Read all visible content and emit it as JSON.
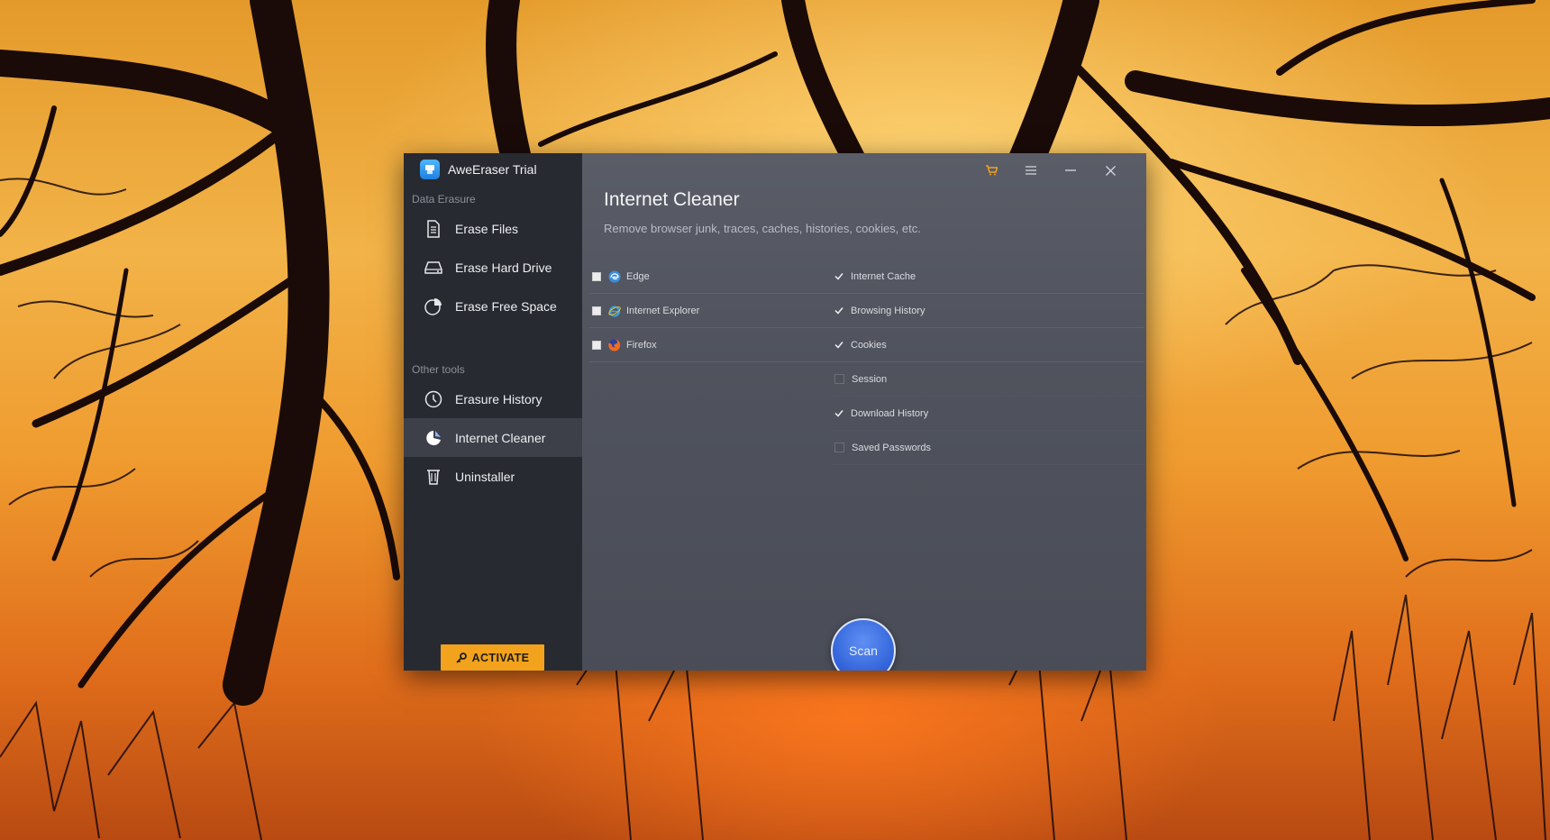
{
  "window": {
    "app_title": "AweEraser Trial",
    "colors": {
      "sidebar": "#282a31",
      "main": "#50535d",
      "accent": "#f2a21c",
      "scan": "#3567dc"
    }
  },
  "sidebar": {
    "data_erasure_label": "Data Erasure",
    "data_erasure_items": [
      {
        "label": "Erase Files",
        "icon": "document-icon"
      },
      {
        "label": "Erase Hard Drive",
        "icon": "hard-drive-icon"
      },
      {
        "label": "Erase Free Space",
        "icon": "pie-chart-icon"
      }
    ],
    "other_tools_label": "Other tools",
    "other_tools_items": [
      {
        "label": "Erasure History",
        "icon": "clock-icon"
      },
      {
        "label": "Internet Cleaner",
        "icon": "broom-icon",
        "active": true
      },
      {
        "label": "Uninstaller",
        "icon": "trash-icon"
      }
    ],
    "activate_label": "ACTIVATE"
  },
  "main": {
    "title": "Internet Cleaner",
    "subtitle": "Remove browser junk, traces, caches, histories, cookies, etc.",
    "browsers": [
      {
        "label": "Edge",
        "icon": "edge-icon",
        "checked": true
      },
      {
        "label": "Internet Explorer",
        "icon": "ie-icon",
        "checked": true
      },
      {
        "label": "Firefox",
        "icon": "firefox-icon",
        "checked": true
      }
    ],
    "options": [
      {
        "label": "Internet Cache",
        "checked": true
      },
      {
        "label": "Browsing History",
        "checked": true
      },
      {
        "label": "Cookies",
        "checked": true
      },
      {
        "label": "Session",
        "checked": false
      },
      {
        "label": "Download History",
        "checked": true
      },
      {
        "label": "Saved Passwords",
        "checked": false
      }
    ],
    "scan_label": "Scan"
  }
}
